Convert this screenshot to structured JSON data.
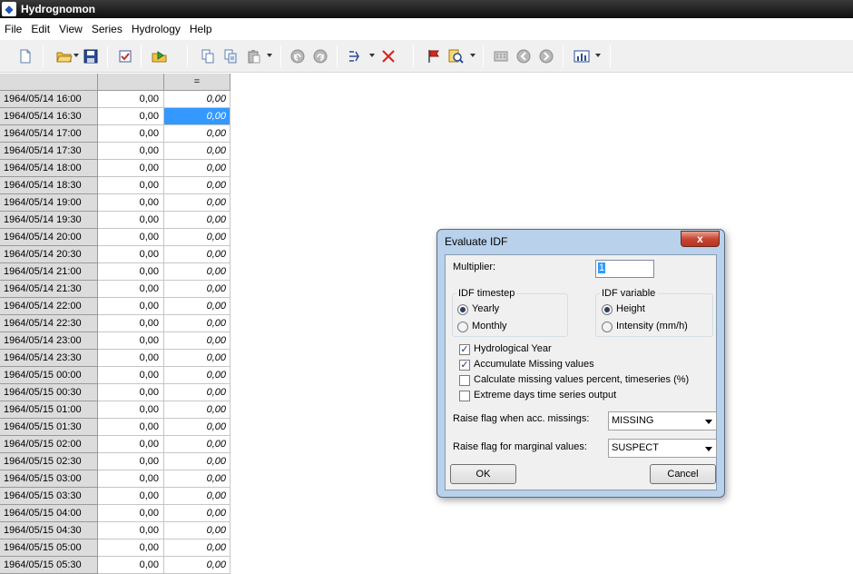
{
  "window": {
    "title": "Hydrognomon"
  },
  "menu": [
    "File",
    "Edit",
    "View",
    "Series",
    "Hydrology",
    "Help"
  ],
  "grid": {
    "headers": [
      "",
      "",
      "="
    ],
    "rows": [
      [
        "1964/05/14 16:00",
        "0,00",
        "0,00"
      ],
      [
        "1964/05/14 16:30",
        "0,00",
        "0,00"
      ],
      [
        "1964/05/14 17:00",
        "0,00",
        "0,00"
      ],
      [
        "1964/05/14 17:30",
        "0,00",
        "0,00"
      ],
      [
        "1964/05/14 18:00",
        "0,00",
        "0,00"
      ],
      [
        "1964/05/14 18:30",
        "0,00",
        "0,00"
      ],
      [
        "1964/05/14 19:00",
        "0,00",
        "0,00"
      ],
      [
        "1964/05/14 19:30",
        "0,00",
        "0,00"
      ],
      [
        "1964/05/14 20:00",
        "0,00",
        "0,00"
      ],
      [
        "1964/05/14 20:30",
        "0,00",
        "0,00"
      ],
      [
        "1964/05/14 21:00",
        "0,00",
        "0,00"
      ],
      [
        "1964/05/14 21:30",
        "0,00",
        "0,00"
      ],
      [
        "1964/05/14 22:00",
        "0,00",
        "0,00"
      ],
      [
        "1964/05/14 22:30",
        "0,00",
        "0,00"
      ],
      [
        "1964/05/14 23:00",
        "0,00",
        "0,00"
      ],
      [
        "1964/05/14 23:30",
        "0,00",
        "0,00"
      ],
      [
        "1964/05/15 00:00",
        "0,00",
        "0,00"
      ],
      [
        "1964/05/15 00:30",
        "0,00",
        "0,00"
      ],
      [
        "1964/05/15 01:00",
        "0,00",
        "0,00"
      ],
      [
        "1964/05/15 01:30",
        "0,00",
        "0,00"
      ],
      [
        "1964/05/15 02:00",
        "0,00",
        "0,00"
      ],
      [
        "1964/05/15 02:30",
        "0,00",
        "0,00"
      ],
      [
        "1964/05/15 03:00",
        "0,00",
        "0,00"
      ],
      [
        "1964/05/15 03:30",
        "0,00",
        "0,00"
      ],
      [
        "1964/05/15 04:00",
        "0,00",
        "0,00"
      ],
      [
        "1964/05/15 04:30",
        "0,00",
        "0,00"
      ],
      [
        "1964/05/15 05:00",
        "0,00",
        "0,00"
      ],
      [
        "1964/05/15 05:30",
        "0,00",
        "0,00"
      ]
    ],
    "selected_row": 1
  },
  "dialog": {
    "title": "Evaluate IDF",
    "close_label": "x",
    "multiplier_label": "Multiplier:",
    "multiplier_value": "1",
    "timestep_group": "IDF timestep",
    "timestep_options": [
      "Yearly",
      "Monthly"
    ],
    "timestep_selected": "Yearly",
    "variable_group": "IDF variable",
    "variable_options": [
      "Height",
      "Intensity (mm/h)"
    ],
    "variable_selected": "Height",
    "checkboxes": [
      {
        "label": "Hydrological Year",
        "checked": true
      },
      {
        "label": "Accumulate Missing values",
        "checked": true
      },
      {
        "label": "Calculate missing values percent, timeseries (%)",
        "checked": false
      },
      {
        "label": "Extreme days time series output",
        "checked": false
      }
    ],
    "missing_flag_label": "Raise flag when acc. missings:",
    "missing_flag_value": "MISSING",
    "marginal_flag_label": "Raise flag for marginal values:",
    "marginal_flag_value": "SUSPECT",
    "ok_label": "OK",
    "cancel_label": "Cancel"
  },
  "toolbar_icons": [
    "new-file-icon",
    "open-folder-icon",
    "save-icon",
    "properties-icon",
    "import-icon",
    "copy-icon",
    "copy-special-icon",
    "paste-icon",
    "undo-icon",
    "redo-icon",
    "series-list-icon",
    "delete-icon",
    "flag-icon",
    "find-icon",
    "calculator-icon",
    "back-icon",
    "forward-icon",
    "chart-icon"
  ],
  "colors": {
    "selection": "#3399ff",
    "dialog_frame": "#b9d1ea",
    "close_button": "#c74632"
  }
}
